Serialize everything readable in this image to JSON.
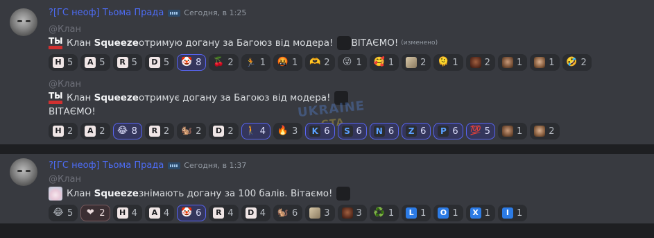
{
  "messages": [
    {
      "author": "?[ГС неоф] Тьома  Прада",
      "timestamp": "Сегодня, в 1:25",
      "lines": [
        {
          "mention": "@Клан",
          "pre": "Клан ",
          "bold": "Squeeze",
          "post": " отримую догану за Багоюз від модера!",
          "tail": " ВІТАЄМО!",
          "edited": "(изменено)"
        },
        {
          "mention": "@Клан",
          "pre": "Клан ",
          "bold": "Squeeze",
          "post": "  отримує догану за Багоюз від модера!",
          "second": "ВІТАЄМО!"
        }
      ],
      "reactions_row1": [
        {
          "icon": "H",
          "kind": "let",
          "count": "5"
        },
        {
          "icon": "A",
          "kind": "let",
          "count": "5"
        },
        {
          "icon": "R",
          "kind": "let",
          "count": "5"
        },
        {
          "icon": "D",
          "kind": "let",
          "count": "5"
        },
        {
          "icon": "🤡",
          "kind": "emoji",
          "count": "8",
          "me": true
        },
        {
          "icon": "🍒",
          "kind": "emoji",
          "count": "2"
        },
        {
          "icon": "🏃",
          "kind": "swim",
          "count": "1"
        },
        {
          "icon": "🤬",
          "kind": "emoji",
          "count": "1"
        },
        {
          "icon": "🫶",
          "kind": "emoji",
          "count": "2"
        },
        {
          "icon": "😜",
          "kind": "emoji",
          "count": "1"
        },
        {
          "icon": "🥰",
          "kind": "emoji",
          "count": "1"
        },
        {
          "icon": "",
          "kind": "pic",
          "count": "2"
        },
        {
          "icon": "🫠",
          "kind": "emoji",
          "count": "1"
        },
        {
          "icon": "",
          "kind": "face3",
          "count": "2"
        },
        {
          "icon": "",
          "kind": "face",
          "count": "1"
        },
        {
          "icon": "",
          "kind": "face2",
          "count": "1"
        },
        {
          "icon": "🤣",
          "kind": "emoji",
          "count": "2"
        }
      ],
      "reactions_row2": [
        {
          "icon": "H",
          "kind": "let",
          "count": "2"
        },
        {
          "icon": "A",
          "kind": "let",
          "count": "2"
        },
        {
          "icon": "😂",
          "kind": "emoji",
          "count": "8",
          "me": true
        },
        {
          "icon": "R",
          "kind": "let",
          "count": "2"
        },
        {
          "icon": "🐿️",
          "kind": "emoji",
          "count": "2"
        },
        {
          "icon": "D",
          "kind": "let",
          "count": "2"
        },
        {
          "icon": "🚶",
          "kind": "emoji",
          "count": "4",
          "me": true
        },
        {
          "icon": "🔥",
          "kind": "emoji",
          "count": "3"
        },
        {
          "icon": "K",
          "kind": "swim",
          "count": "6",
          "me": true
        },
        {
          "icon": "S",
          "kind": "swim",
          "count": "6",
          "me": true
        },
        {
          "icon": "N",
          "kind": "swim",
          "count": "6",
          "me": true
        },
        {
          "icon": "Z",
          "kind": "swim",
          "count": "6",
          "me": true
        },
        {
          "icon": "P",
          "kind": "swim",
          "count": "6",
          "me": true
        },
        {
          "icon": "💯",
          "kind": "emoji",
          "count": "5",
          "me": true
        },
        {
          "icon": "",
          "kind": "face",
          "count": "1"
        },
        {
          "icon": "",
          "kind": "face2",
          "count": "2"
        }
      ]
    },
    {
      "author": "?[ГС неоф] Тьома  Прада",
      "timestamp": "Сегодня, в 1:37",
      "lines": [
        {
          "mention": "@Клан",
          "pre": "Клан ",
          "bold": "Squeeze",
          "post": " знімають догану за 100 балів. Вітаємо!"
        }
      ],
      "reactions_row1": [
        {
          "icon": "😂",
          "kind": "emoji",
          "count": "5"
        },
        {
          "icon": "❤",
          "kind": "emoji",
          "count": "2",
          "me2": true
        },
        {
          "icon": "H",
          "kind": "let",
          "count": "4"
        },
        {
          "icon": "A",
          "kind": "let",
          "count": "4"
        },
        {
          "icon": "🤡",
          "kind": "emoji",
          "count": "6",
          "me": true
        },
        {
          "icon": "R",
          "kind": "let",
          "count": "4"
        },
        {
          "icon": "D",
          "kind": "let",
          "count": "4"
        },
        {
          "icon": "🐿️",
          "kind": "emoji",
          "count": "6"
        },
        {
          "icon": "",
          "kind": "pic",
          "count": "3"
        },
        {
          "icon": "",
          "kind": "face3",
          "count": "3"
        },
        {
          "icon": "♻️",
          "kind": "emoji",
          "count": "1"
        },
        {
          "icon": "L",
          "kind": "blue",
          "count": "1"
        },
        {
          "icon": "O",
          "kind": "blue",
          "count": "1"
        },
        {
          "icon": "X",
          "kind": "blue",
          "count": "1"
        },
        {
          "icon": "I",
          "kind": "blue",
          "count": "1"
        }
      ]
    }
  ],
  "watermark": {
    "top": "UKRAINE",
    "bottom": "GTA"
  },
  "colors": {
    "background": "#383a40",
    "username": "#4d6cf5",
    "reaction_me": "#5865f2"
  }
}
